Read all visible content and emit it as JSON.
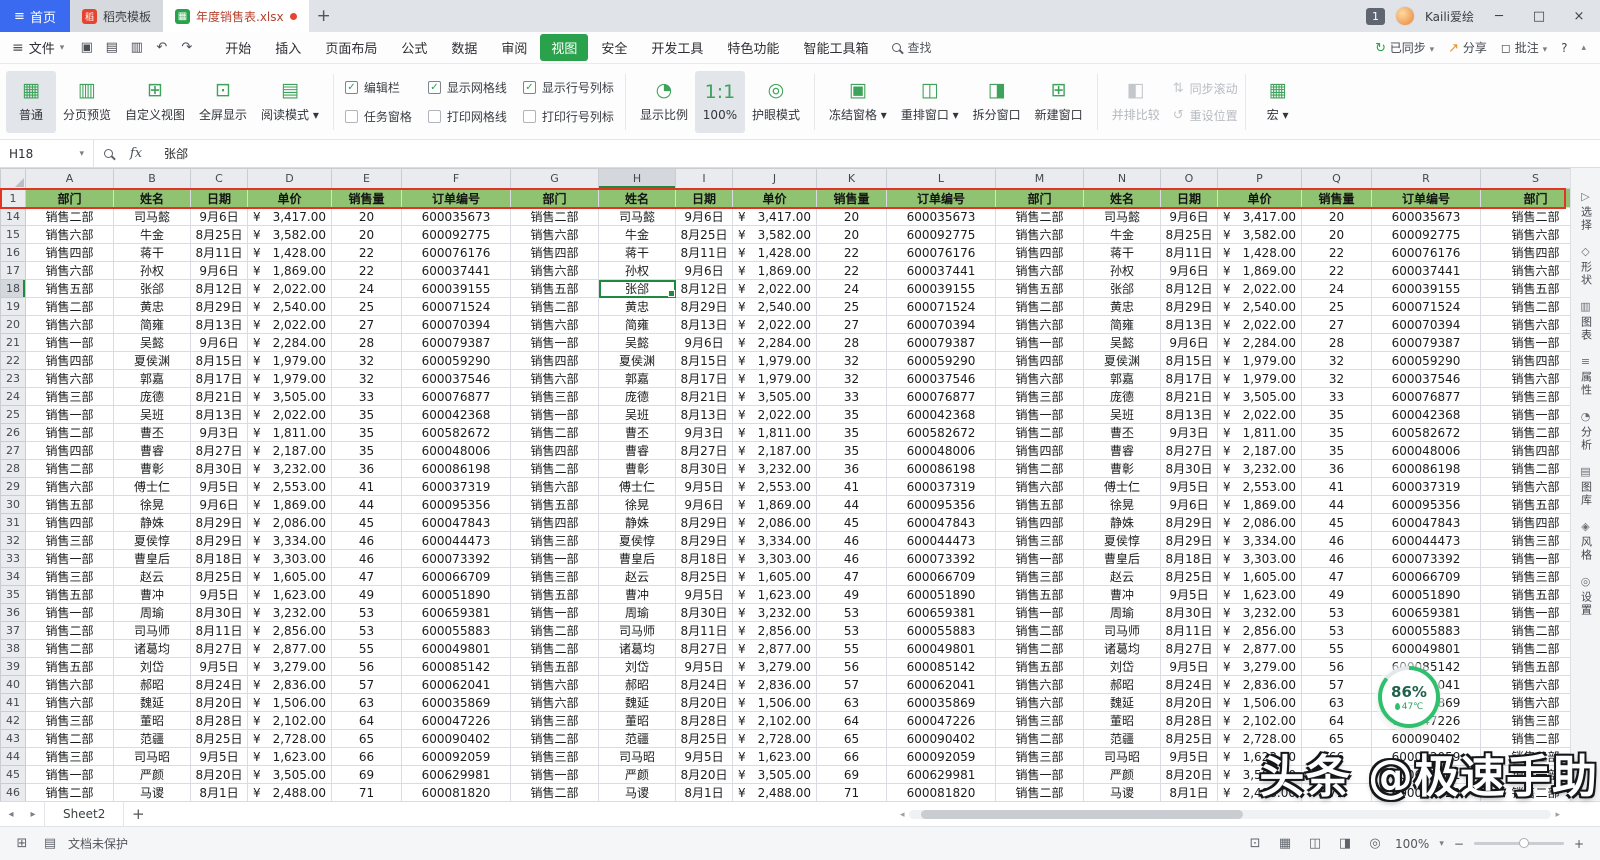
{
  "colors": {
    "accent_green": "#2aa14b",
    "home_blue": "#3a6af0",
    "annotation_red": "#e23323",
    "header_fill_green": "#8fc271",
    "doc_title_red": "#b5422e"
  },
  "window": {
    "tabs": {
      "home_button": "首页",
      "docer_tab": "稻壳模板",
      "docer_icon": "稻",
      "doc_tab": "年度销售表.xlsx",
      "doc_icon": "▦",
      "new_tab_icon": "+",
      "badge": "1",
      "user_name": "Kaili爱绘"
    },
    "controls": {
      "minimize": "─",
      "maximize": "□",
      "close": "×"
    }
  },
  "menubar": {
    "file_menu": "文件",
    "quick_icons": [
      {
        "name": "save",
        "glyph": "▣"
      },
      {
        "name": "print",
        "glyph": "▤"
      },
      {
        "name": "print-preview",
        "glyph": "▥"
      },
      {
        "name": "undo",
        "glyph": "↶"
      },
      {
        "name": "redo",
        "glyph": "↷"
      }
    ],
    "menus": [
      {
        "label": "开始",
        "name": "start"
      },
      {
        "label": "插入",
        "name": "insert"
      },
      {
        "label": "页面布局",
        "name": "page-layout"
      },
      {
        "label": "公式",
        "name": "formulas"
      },
      {
        "label": "数据",
        "name": "data"
      },
      {
        "label": "审阅",
        "name": "review"
      },
      {
        "label": "视图",
        "name": "view"
      },
      {
        "label": "安全",
        "name": "security"
      },
      {
        "label": "开发工具",
        "name": "dev-tools"
      },
      {
        "label": "特色功能",
        "name": "special-features"
      },
      {
        "label": "智能工具箱",
        "name": "smart-toolbox"
      }
    ],
    "active_menu": "视图",
    "search_label": "查找",
    "synced_label": "已同步",
    "share_label": "分享",
    "comment_label": "批注",
    "help_label": "?"
  },
  "ribbon": {
    "view_buttons": [
      {
        "label": "普通",
        "name": "normal-view",
        "icon": "▦",
        "active": true
      },
      {
        "label": "分页预览",
        "name": "page-break-preview",
        "icon": "▥",
        "active": false
      },
      {
        "label": "自定义视图",
        "name": "custom-view",
        "icon": "⊞",
        "active": false
      },
      {
        "label": "全屏显示",
        "name": "full-screen",
        "icon": "⊡",
        "active": false
      },
      {
        "label": "阅读模式",
        "name": "read-mode",
        "icon": "▤",
        "active": false,
        "dropdown": true
      }
    ],
    "checkboxes": [
      {
        "label": "编辑栏",
        "name": "edit-bar",
        "checked": true
      },
      {
        "label": "任务窗格",
        "name": "task-pane",
        "checked": false
      },
      {
        "label": "显示网格线",
        "name": "show-gridlines",
        "checked": true
      },
      {
        "label": "打印网格线",
        "name": "print-gridlines",
        "checked": false
      },
      {
        "label": "显示行号列标",
        "name": "show-headings",
        "checked": true
      },
      {
        "label": "打印行号列标",
        "name": "print-headings",
        "checked": false
      }
    ],
    "zoom_group": [
      {
        "label": "显示比例",
        "name": "zoom-scale",
        "icon": "◔",
        "active": false
      },
      {
        "label": "100%",
        "name": "zoom-100",
        "icon": "1:1",
        "active": true
      },
      {
        "label": "护眼模式",
        "name": "eye-protection",
        "icon": "◎",
        "active": false
      }
    ],
    "window_group": [
      {
        "label": "冻结窗格",
        "name": "freeze-panes",
        "icon": "▣",
        "dropdown": true
      },
      {
        "label": "重排窗口",
        "name": "rearrange-windows",
        "icon": "◫",
        "dropdown": true
      },
      {
        "label": "拆分窗口",
        "name": "split-window",
        "icon": "◨",
        "dropdown": false
      },
      {
        "label": "新建窗口",
        "name": "new-window",
        "icon": "⊞",
        "dropdown": false
      }
    ],
    "disabled_group": [
      {
        "label": "并排比较",
        "name": "side-by-side",
        "icon": "◧"
      },
      {
        "label": "同步滚动",
        "name": "sync-scroll",
        "icon": "⇅"
      },
      {
        "label": "重设位置",
        "name": "reset-position",
        "icon": "↺"
      }
    ],
    "macro": {
      "label": "宏",
      "name": "macro",
      "icon": "▦",
      "dropdown": true
    }
  },
  "formula_bar": {
    "name_box": "H18",
    "fx_label": "fx",
    "content": "张郃"
  },
  "sheet": {
    "column_letters": [
      "A",
      "B",
      "C",
      "D",
      "E",
      "F",
      "G",
      "H",
      "I",
      "J",
      "K",
      "L",
      "M",
      "N",
      "O",
      "P",
      "Q",
      "R",
      "S"
    ],
    "selected_column": "H",
    "selected_row": 18,
    "selected_cell_ref": "H18",
    "header_labels": [
      "部门",
      "姓名",
      "日期",
      "单价",
      "销售量",
      "订单编号"
    ],
    "rows": [
      {
        "n": 14,
        "dept": "销售二部",
        "name": "司马懿",
        "date": "9月6日",
        "price": "¥3,417.00",
        "qty": "20",
        "order": "600035673"
      },
      {
        "n": 15,
        "dept": "销售六部",
        "name": "牛金",
        "date": "8月25日",
        "price": "¥3,582.00",
        "qty": "20",
        "order": "600092775"
      },
      {
        "n": 16,
        "dept": "销售四部",
        "name": "蒋干",
        "date": "8月11日",
        "price": "¥1,428.00",
        "qty": "22",
        "order": "600076176"
      },
      {
        "n": 17,
        "dept": "销售六部",
        "name": "孙权",
        "date": "9月6日",
        "price": "¥1,869.00",
        "qty": "22",
        "order": "600037441"
      },
      {
        "n": 18,
        "dept": "销售五部",
        "name": "张郃",
        "date": "8月12日",
        "price": "¥2,022.00",
        "qty": "24",
        "order": "600039155"
      },
      {
        "n": 19,
        "dept": "销售二部",
        "name": "黄忠",
        "date": "8月29日",
        "price": "¥2,540.00",
        "qty": "25",
        "order": "600071524"
      },
      {
        "n": 20,
        "dept": "销售六部",
        "name": "简雍",
        "date": "8月13日",
        "price": "¥2,022.00",
        "qty": "27",
        "order": "600070394"
      },
      {
        "n": 21,
        "dept": "销售一部",
        "name": "吴懿",
        "date": "9月6日",
        "price": "¥2,284.00",
        "qty": "28",
        "order": "600079387"
      },
      {
        "n": 22,
        "dept": "销售四部",
        "name": "夏侯渊",
        "date": "8月15日",
        "price": "¥1,979.00",
        "qty": "32",
        "order": "600059290"
      },
      {
        "n": 23,
        "dept": "销售六部",
        "name": "郭嘉",
        "date": "8月17日",
        "price": "¥1,979.00",
        "qty": "32",
        "order": "600037546"
      },
      {
        "n": 24,
        "dept": "销售三部",
        "name": "庞德",
        "date": "8月21日",
        "price": "¥3,505.00",
        "qty": "33",
        "order": "600076877"
      },
      {
        "n": 25,
        "dept": "销售一部",
        "name": "吴班",
        "date": "8月13日",
        "price": "¥2,022.00",
        "qty": "35",
        "order": "600042368"
      },
      {
        "n": 26,
        "dept": "销售二部",
        "name": "曹丕",
        "date": "9月3日",
        "price": "¥1,811.00",
        "qty": "35",
        "order": "600582672"
      },
      {
        "n": 27,
        "dept": "销售四部",
        "name": "曹睿",
        "date": "8月27日",
        "price": "¥2,187.00",
        "qty": "35",
        "order": "600048006"
      },
      {
        "n": 28,
        "dept": "销售二部",
        "name": "曹彰",
        "date": "8月30日",
        "price": "¥3,232.00",
        "qty": "36",
        "order": "600086198"
      },
      {
        "n": 29,
        "dept": "销售六部",
        "name": "傅士仁",
        "date": "9月5日",
        "price": "¥2,553.00",
        "qty": "41",
        "order": "600037319"
      },
      {
        "n": 30,
        "dept": "销售五部",
        "name": "徐晃",
        "date": "9月6日",
        "price": "¥1,869.00",
        "qty": "44",
        "order": "600095356"
      },
      {
        "n": 31,
        "dept": "销售四部",
        "name": "静姝",
        "date": "8月29日",
        "price": "¥2,086.00",
        "qty": "45",
        "order": "600047843"
      },
      {
        "n": 32,
        "dept": "销售三部",
        "name": "夏侯惇",
        "date": "8月29日",
        "price": "¥3,334.00",
        "qty": "46",
        "order": "600044473"
      },
      {
        "n": 33,
        "dept": "销售一部",
        "name": "曹皇后",
        "date": "8月18日",
        "price": "¥3,303.00",
        "qty": "46",
        "order": "600073392"
      },
      {
        "n": 34,
        "dept": "销售三部",
        "name": "赵云",
        "date": "8月25日",
        "price": "¥1,605.00",
        "qty": "47",
        "order": "600066709"
      },
      {
        "n": 35,
        "dept": "销售五部",
        "name": "曹冲",
        "date": "9月5日",
        "price": "¥1,623.00",
        "qty": "49",
        "order": "600051890"
      },
      {
        "n": 36,
        "dept": "销售一部",
        "name": "周瑜",
        "date": "8月30日",
        "price": "¥3,232.00",
        "qty": "53",
        "order": "600659381"
      },
      {
        "n": 37,
        "dept": "销售二部",
        "name": "司马师",
        "date": "8月11日",
        "price": "¥2,856.00",
        "qty": "53",
        "order": "600055883"
      },
      {
        "n": 38,
        "dept": "销售二部",
        "name": "诸葛均",
        "date": "8月27日",
        "price": "¥2,877.00",
        "qty": "55",
        "order": "600049801"
      },
      {
        "n": 39,
        "dept": "销售五部",
        "name": "刘岱",
        "date": "9月5日",
        "price": "¥3,279.00",
        "qty": "56",
        "order": "600085142"
      },
      {
        "n": 40,
        "dept": "销售六部",
        "name": "郝昭",
        "date": "8月24日",
        "price": "¥2,836.00",
        "qty": "57",
        "order": "600062041"
      },
      {
        "n": 41,
        "dept": "销售六部",
        "name": "魏延",
        "date": "8月20日",
        "price": "¥1,506.00",
        "qty": "63",
        "order": "600035869"
      },
      {
        "n": 42,
        "dept": "销售三部",
        "name": "董昭",
        "date": "8月28日",
        "price": "¥2,102.00",
        "qty": "64",
        "order": "600047226"
      },
      {
        "n": 43,
        "dept": "销售二部",
        "name": "范疆",
        "date": "8月25日",
        "price": "¥2,728.00",
        "qty": "65",
        "order": "600090402"
      },
      {
        "n": 44,
        "dept": "销售三部",
        "name": "司马昭",
        "date": "9月5日",
        "price": "¥1,623.00",
        "qty": "66",
        "order": "600092059"
      },
      {
        "n": 45,
        "dept": "销售一部",
        "name": "严颜",
        "date": "8月20日",
        "price": "¥3,505.00",
        "qty": "69",
        "order": "600629981"
      },
      {
        "n": 46,
        "dept": "销售二部",
        "name": "马谡",
        "date": "8月1日",
        "price": "¥2,488.00",
        "qty": "71",
        "order": "600081820"
      }
    ]
  },
  "right_panel": {
    "items": [
      {
        "label": "选择",
        "name": "select",
        "icon": "▷"
      },
      {
        "label": "形状",
        "name": "shapes",
        "icon": "◇"
      },
      {
        "label": "图表",
        "name": "chart",
        "icon": "▥"
      },
      {
        "label": "属性",
        "name": "properties",
        "icon": "≡"
      },
      {
        "label": "分析",
        "name": "analysis",
        "icon": "◔"
      },
      {
        "label": "图库",
        "name": "gallery",
        "icon": "▤"
      },
      {
        "label": "风格",
        "name": "style",
        "icon": "◈"
      },
      {
        "label": "设置",
        "name": "settings",
        "icon": "◎"
      }
    ]
  },
  "sheetbar": {
    "sheet_name": "Sheet2",
    "add_icon": "+"
  },
  "statusbar": {
    "protect_label": "文档未保护",
    "zoom_value": "100%"
  },
  "overlays": {
    "watermark": "头条 @极速手助",
    "gauge_percent": "86%",
    "gauge_temp": "47℃"
  }
}
